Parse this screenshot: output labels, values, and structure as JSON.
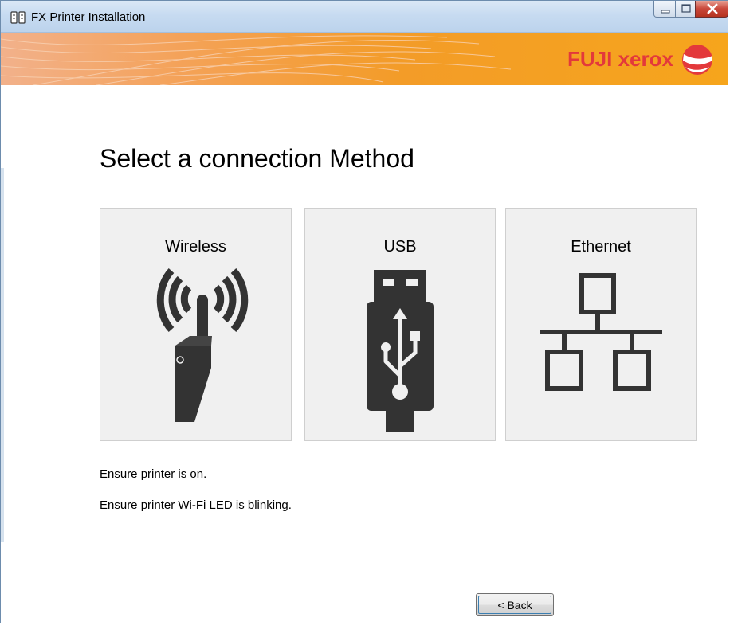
{
  "window": {
    "title": "FX Printer Installation",
    "app_icon": "printer-installer-icon",
    "controls": {
      "minimize": "minimize-icon",
      "maximize": "maximize-icon",
      "close": "close-icon"
    }
  },
  "banner": {
    "logo_text": "FUJI xerox",
    "logo_mark": "xerox-sphere-logo",
    "colors": {
      "banner_orange": "#f39c28",
      "logo_red": "#e3393b"
    }
  },
  "main": {
    "heading": "Select a connection Method",
    "options": [
      {
        "label": "Wireless",
        "icon": "wireless-router-icon"
      },
      {
        "label": "USB",
        "icon": "usb-drive-icon"
      },
      {
        "label": "Ethernet",
        "icon": "network-topology-icon"
      }
    ],
    "notes": [
      "Ensure printer is on.",
      "Ensure printer Wi-Fi LED is blinking."
    ]
  },
  "footer": {
    "back_label": "< Back"
  }
}
